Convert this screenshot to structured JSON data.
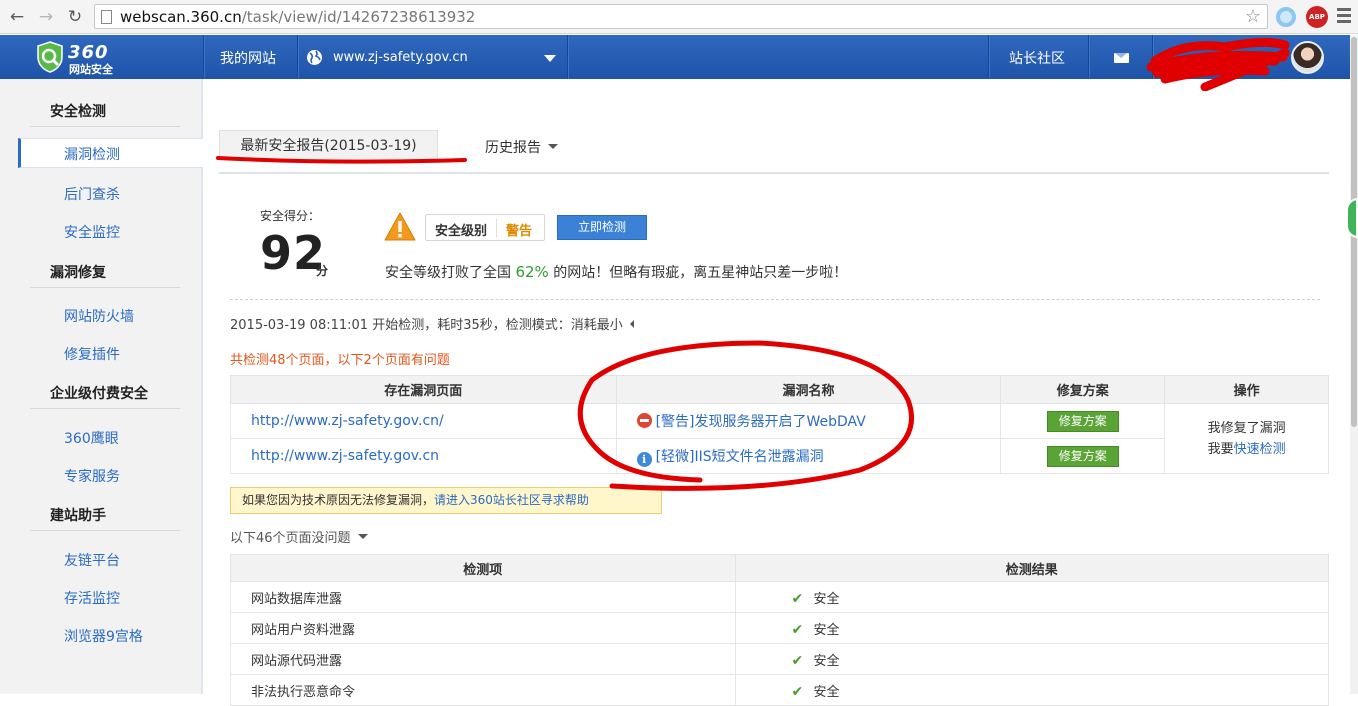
{
  "browser": {
    "url_host": "webscan.360.cn",
    "url_path": "/task/view/id/14267238613932",
    "ext_abp": "ABP"
  },
  "header": {
    "logo_num": "360",
    "logo_sub": "网站安全",
    "my_site": "我的网站",
    "site_domain": "www.zj-safety.gov.cn",
    "community": "站长社区"
  },
  "sidebar": {
    "sections": [
      {
        "title": "安全检测",
        "items": [
          "漏洞检测",
          "后门查杀",
          "安全监控"
        ]
      },
      {
        "title": "漏洞修复",
        "items": [
          "网站防火墙",
          "修复插件"
        ]
      },
      {
        "title": "企业级付费安全",
        "items": [
          "360鹰眼",
          "专家服务"
        ]
      },
      {
        "title": "建站助手",
        "items": [
          "友链平台",
          "存活监控",
          "浏览器9宫格"
        ]
      }
    ]
  },
  "tabs": {
    "latest": "最新安全报告(2015-03-19)",
    "history": "历史报告"
  },
  "score": {
    "label": "安全得分：",
    "value": "92",
    "unit": "分",
    "level_key": "安全级别",
    "level_value": "警告",
    "scan_button": "立即检测",
    "rank_prefix": "安全等级打败了全国 ",
    "rank_pct": "62%",
    "rank_suffix": " 的网站！但略有瑕疵，离五星神站只差一步啦！"
  },
  "scan_info": "2015-03-19 08:11:01 开始检测，耗时35秒，检测模式：消耗最小",
  "summary": "共检测48个页面，以下2个页面有问题",
  "vuln_table": {
    "headers": [
      "存在漏洞页面",
      "漏洞名称",
      "修复方案",
      "操作"
    ],
    "rows": [
      {
        "url": "http://www.zj-safety.gov.cn/",
        "name": "[警告]发现服务器开启了WebDAV",
        "fix": "修复方案"
      },
      {
        "url": "http://www.zj-safety.gov.cn",
        "name": "[轻微]IIS短文件名泄露漏洞",
        "fix": "修复方案"
      }
    ],
    "op_line1": "我修复了漏洞",
    "op_line2_prefix": "我要",
    "op_line2_link": "快速检测"
  },
  "tip": {
    "text": "如果您因为技术原因无法修复漏洞，",
    "link": "请进入360站长社区寻求帮助"
  },
  "ok_summary": "以下46个页面没问题",
  "check_table": {
    "headers": [
      "检测项",
      "检测结果"
    ],
    "rows": [
      {
        "item": "网站数据库泄露",
        "result": "安全"
      },
      {
        "item": "网站用户资料泄露",
        "result": "安全"
      },
      {
        "item": "网站源代码泄露",
        "result": "安全"
      },
      {
        "item": "非法执行恶意命令",
        "result": "安全"
      }
    ]
  },
  "colors": {
    "header_blue": "#2a5eb4",
    "link_blue": "#2a6bc4",
    "warn_orange": "#e08a00",
    "fix_green": "#5aa435",
    "annotation_red": "#e00000"
  }
}
